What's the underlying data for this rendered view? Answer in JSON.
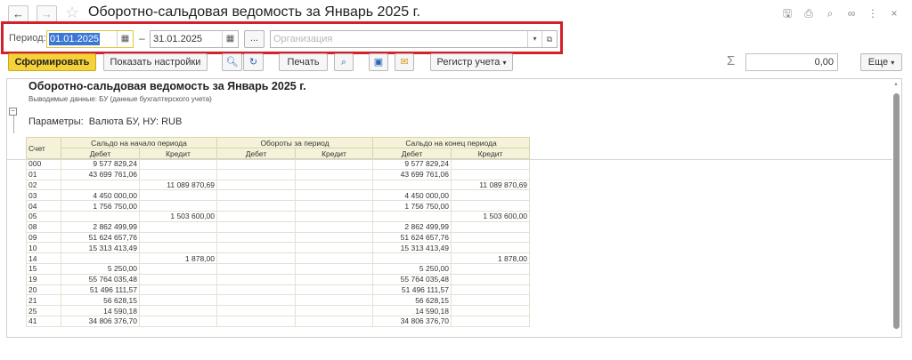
{
  "window": {
    "title": "Оборотно-сальдовая ведомость за Январь 2025 г.",
    "icons": [
      "save-icon",
      "print-icon",
      "preview-icon",
      "link-icon",
      "more-vertical-icon",
      "close-icon"
    ]
  },
  "period": {
    "label": "Период:",
    "start": "01.01.2025",
    "separator": "–",
    "end": "31.01.2025",
    "dots_label": "...",
    "org_placeholder": "Организация"
  },
  "toolbar": {
    "form_label": "Сформировать",
    "settings_label": "Показать настройки",
    "print_label": "Печать",
    "register_label": "Регистр учета",
    "sum_value": "0,00",
    "more_label": "Еще"
  },
  "report": {
    "title": "Оборотно-сальдовая ведомость за Январь 2025 г.",
    "subtitle": "Выводимые данные: БУ (данные бухгалтерского учета)",
    "params_label": "Параметры:",
    "params_value": "Валюта БУ, НУ: RUB",
    "headers": {
      "account": "Счет",
      "opening": "Сальдо на начало периода",
      "turnover": "Обороты за период",
      "closing": "Сальдо на конец периода",
      "debit": "Дебет",
      "credit": "Кредит"
    },
    "rows": [
      {
        "account": "000",
        "od": "9 577 829,24",
        "oc": "",
        "td": "",
        "tc": "",
        "cd": "9 577 829,24",
        "cc": ""
      },
      {
        "account": "01",
        "od": "43 699 761,06",
        "oc": "",
        "td": "",
        "tc": "",
        "cd": "43 699 761,06",
        "cc": ""
      },
      {
        "account": "02",
        "od": "",
        "oc": "11 089 870,69",
        "td": "",
        "tc": "",
        "cd": "",
        "cc": "11 089 870,69"
      },
      {
        "account": "03",
        "od": "4 450 000,00",
        "oc": "",
        "td": "",
        "tc": "",
        "cd": "4 450 000,00",
        "cc": ""
      },
      {
        "account": "04",
        "od": "1 756 750,00",
        "oc": "",
        "td": "",
        "tc": "",
        "cd": "1 756 750,00",
        "cc": ""
      },
      {
        "account": "05",
        "od": "",
        "oc": "1 503 600,00",
        "td": "",
        "tc": "",
        "cd": "",
        "cc": "1 503 600,00"
      },
      {
        "account": "08",
        "od": "2 862 499,99",
        "oc": "",
        "td": "",
        "tc": "",
        "cd": "2 862 499,99",
        "cc": ""
      },
      {
        "account": "09",
        "od": "51 624 657,76",
        "oc": "",
        "td": "",
        "tc": "",
        "cd": "51 624 657,76",
        "cc": ""
      },
      {
        "account": "10",
        "od": "15 313 413,49",
        "oc": "",
        "td": "",
        "tc": "",
        "cd": "15 313 413,49",
        "cc": ""
      },
      {
        "account": "14",
        "od": "",
        "oc": "1 878,00",
        "td": "",
        "tc": "",
        "cd": "",
        "cc": "1 878,00"
      },
      {
        "account": "15",
        "od": "5 250,00",
        "oc": "",
        "td": "",
        "tc": "",
        "cd": "5 250,00",
        "cc": ""
      },
      {
        "account": "19",
        "od": "55 764 035,48",
        "oc": "",
        "td": "",
        "tc": "",
        "cd": "55 764 035,48",
        "cc": ""
      },
      {
        "account": "20",
        "od": "51 496 111,57",
        "oc": "",
        "td": "",
        "tc": "",
        "cd": "51 496 111,57",
        "cc": ""
      },
      {
        "account": "21",
        "od": "56 628,15",
        "oc": "",
        "td": "",
        "tc": "",
        "cd": "56 628,15",
        "cc": ""
      },
      {
        "account": "25",
        "od": "14 590,18",
        "oc": "",
        "td": "",
        "tc": "",
        "cd": "14 590,18",
        "cc": ""
      },
      {
        "account": "41",
        "od": "34 806 376,70",
        "oc": "",
        "td": "",
        "tc": "",
        "cd": "34 806 376,70",
        "cc": ""
      }
    ]
  }
}
